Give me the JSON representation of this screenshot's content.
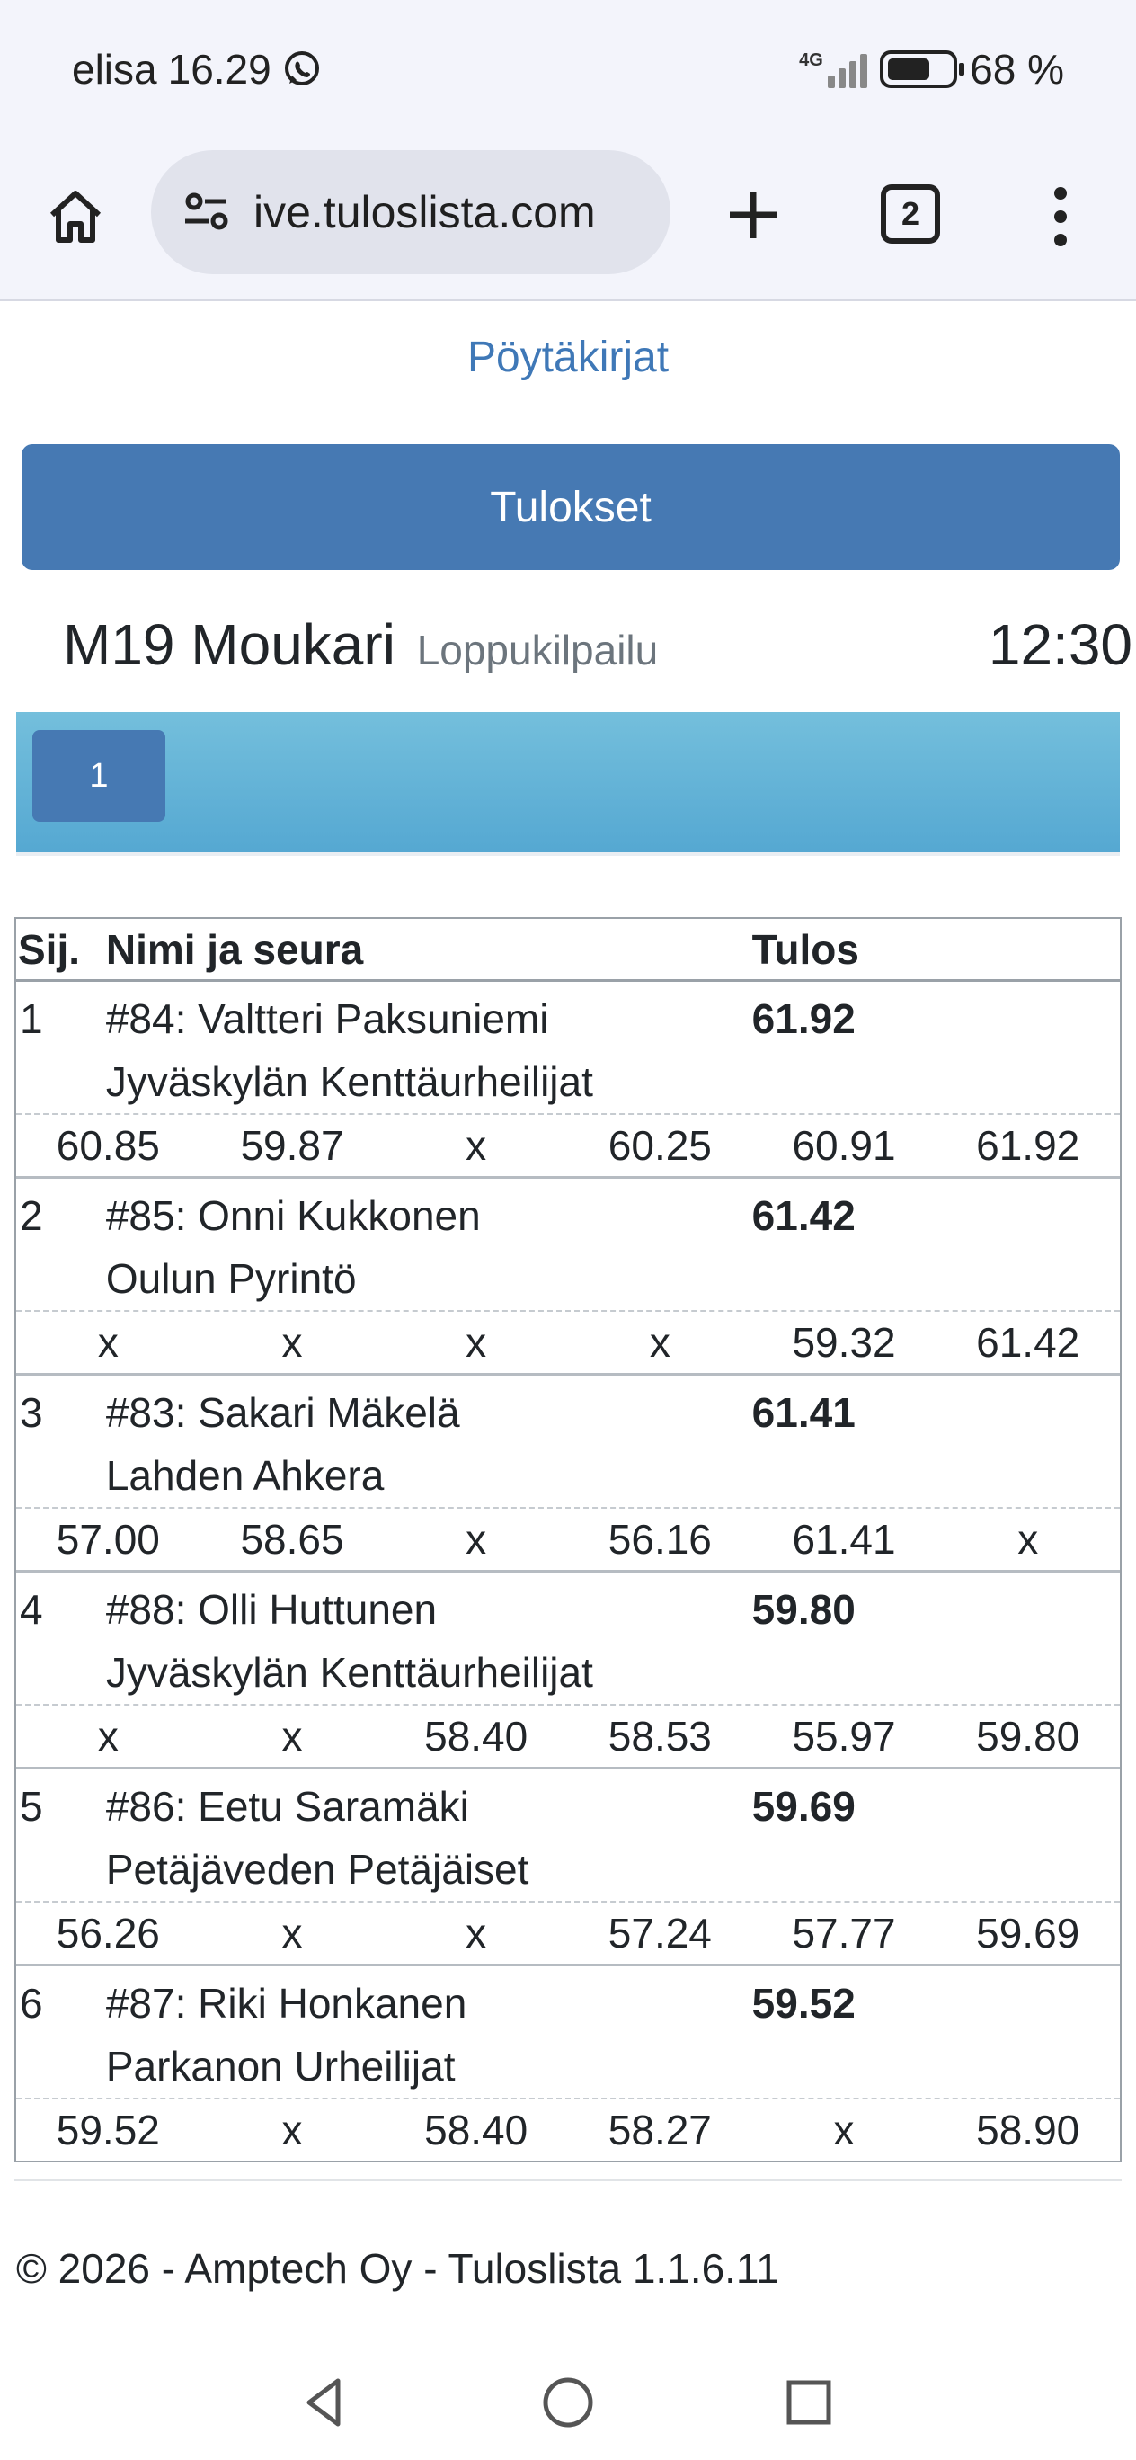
{
  "status_bar": {
    "carrier": "elisa",
    "time": "16.29",
    "network": "4G",
    "battery_percent": "68 %",
    "battery_level": 0.68
  },
  "browser": {
    "url": "ive.tuloslista.com",
    "tab_count": "2"
  },
  "page": {
    "protocol_link": "Pöytäkirjat",
    "results_button": "Tulokset",
    "event_name": "M19 Moukari",
    "event_stage": "Loppukilpailu",
    "event_time": "12:30",
    "heat_label": "1"
  },
  "table": {
    "headers": {
      "rank": "Sij.",
      "name": "Nimi ja seura",
      "result": "Tulos"
    },
    "rows": [
      {
        "rank": "1",
        "name": "#84: Valtteri Paksuniemi",
        "club": "Jyväskylän Kenttäurheilijat",
        "result": "61.92",
        "attempts": [
          "60.85",
          "59.87",
          "x",
          "60.25",
          "60.91",
          "61.92"
        ]
      },
      {
        "rank": "2",
        "name": "#85: Onni Kukkonen",
        "club": "Oulun Pyrintö",
        "result": "61.42",
        "attempts": [
          "x",
          "x",
          "x",
          "x",
          "59.32",
          "61.42"
        ]
      },
      {
        "rank": "3",
        "name": "#83: Sakari Mäkelä",
        "club": "Lahden Ahkera",
        "result": "61.41",
        "attempts": [
          "57.00",
          "58.65",
          "x",
          "56.16",
          "61.41",
          "x"
        ]
      },
      {
        "rank": "4",
        "name": "#88: Olli Huttunen",
        "club": "Jyväskylän Kenttäurheilijat",
        "result": "59.80",
        "attempts": [
          "x",
          "x",
          "58.40",
          "58.53",
          "55.97",
          "59.80"
        ]
      },
      {
        "rank": "5",
        "name": "#86: Eetu Saramäki",
        "club": "Petäjäveden Petäjäiset",
        "result": "59.69",
        "attempts": [
          "56.26",
          "x",
          "x",
          "57.24",
          "57.77",
          "59.69"
        ]
      },
      {
        "rank": "6",
        "name": "#87: Riki Honkanen",
        "club": "Parkanon Urheilijat",
        "result": "59.52",
        "attempts": [
          "59.52",
          "x",
          "58.40",
          "58.27",
          "x",
          "58.90"
        ]
      }
    ]
  },
  "footer": {
    "text": "© 2026 - Amptech Oy - Tuloslista 1.1.6.11"
  },
  "colors": {
    "primary": "#4679b3",
    "link": "#3f78b7",
    "heat_bar": "#5fb0d6",
    "chrome_bg": "#f3f4fb"
  }
}
